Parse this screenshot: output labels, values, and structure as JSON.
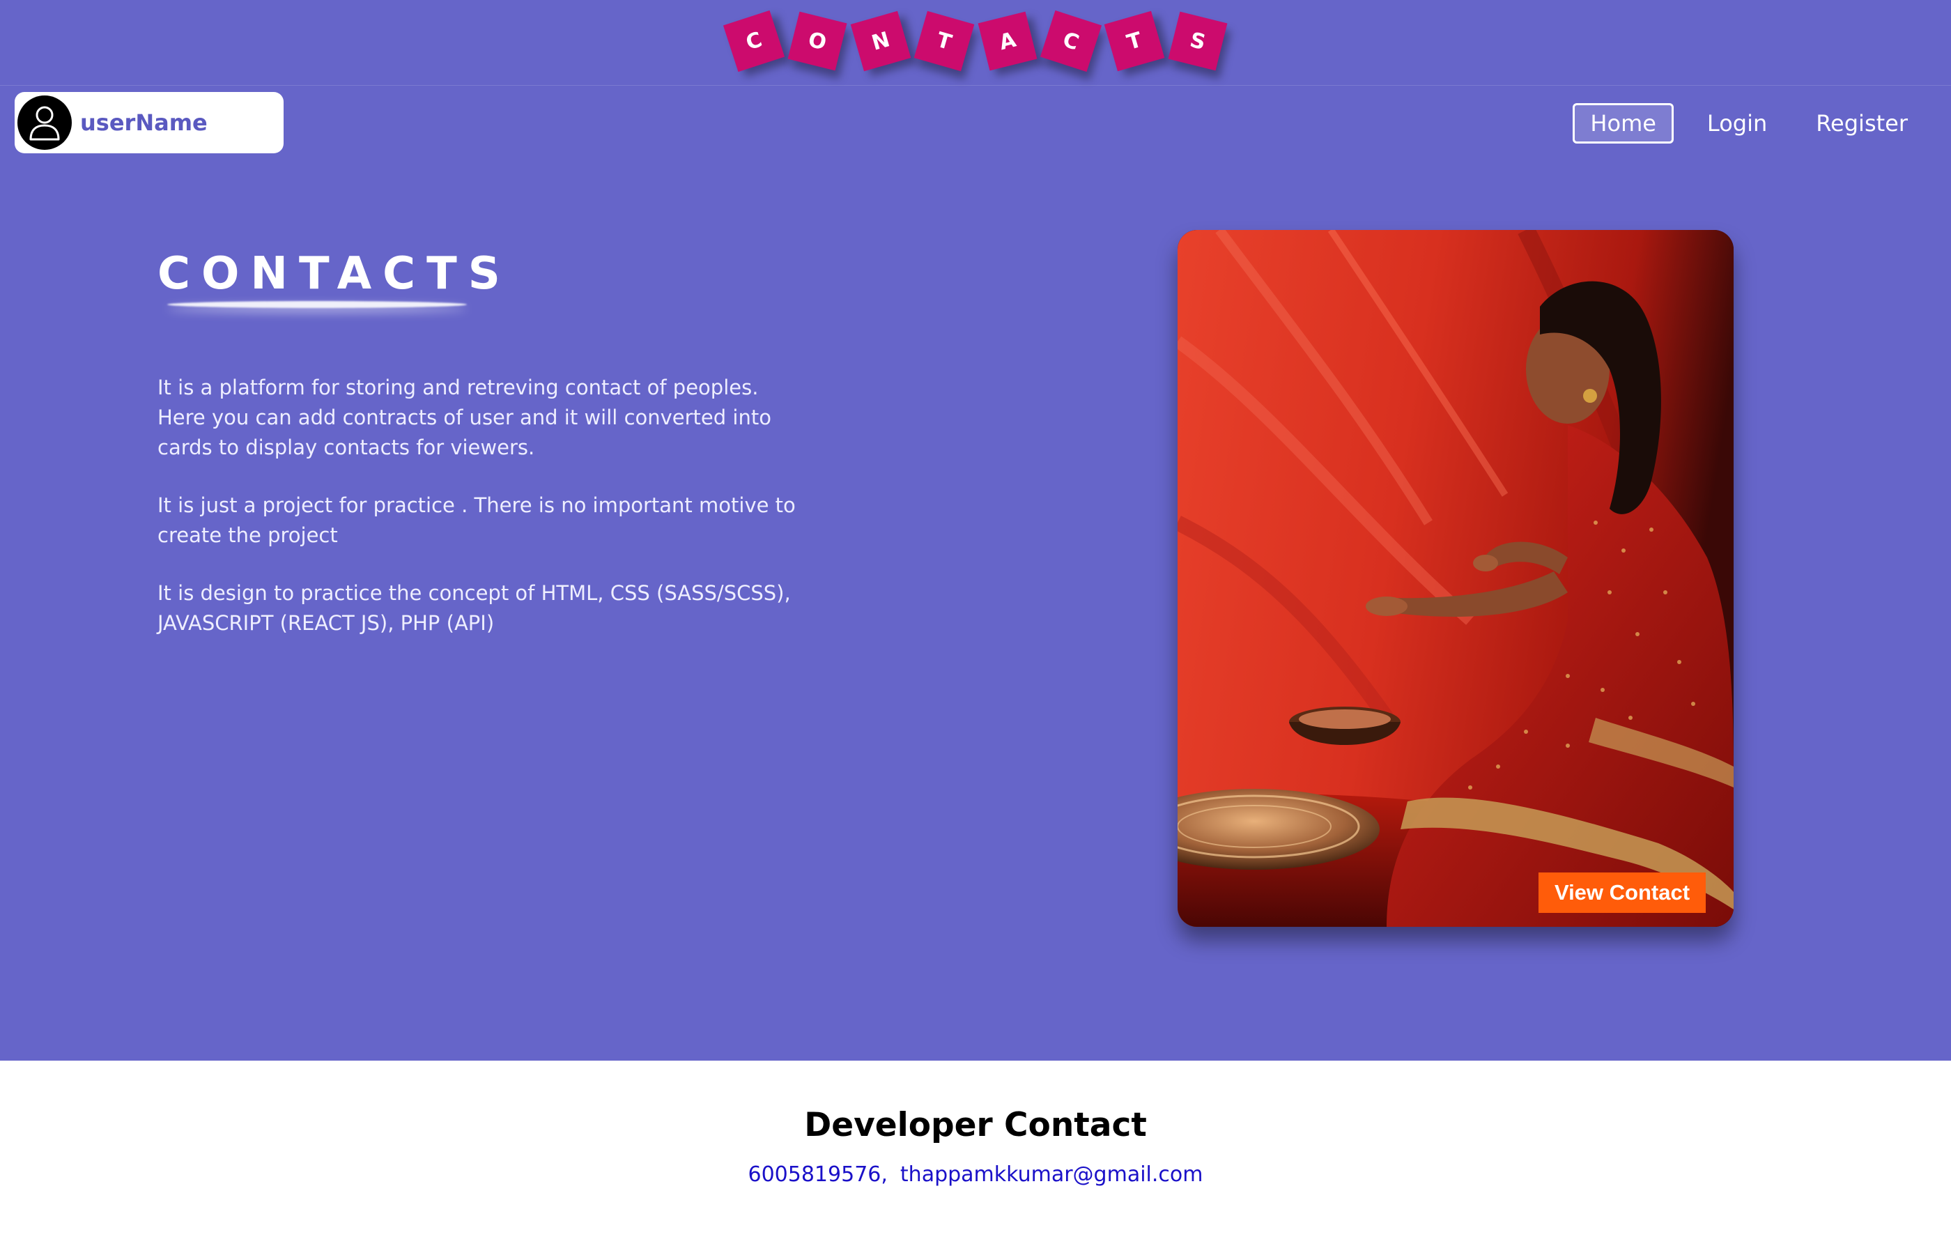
{
  "banner": {
    "letters": [
      "C",
      "O",
      "N",
      "T",
      "A",
      "C",
      "T",
      "S"
    ]
  },
  "user": {
    "name": "userName",
    "avatar_icon": "user-avatar-icon"
  },
  "nav": {
    "items": [
      {
        "label": "Home",
        "active": true
      },
      {
        "label": "Login",
        "active": false
      },
      {
        "label": "Register",
        "active": false
      }
    ]
  },
  "hero": {
    "title": "CONTACTS",
    "paragraphs": [
      "It is a platform for storing and retreving contact of peoples. Here you can add contracts of user and it will converted into cards to display contacts for viewers.",
      "It is just a project for practice . There is no important motive to create the project",
      "It is design to practice the concept of HTML, CSS (SASS/SCSS), JAVASCRIPT (REACT JS), PHP (API)"
    ]
  },
  "card": {
    "button_label": "View Contact"
  },
  "footer": {
    "title": "Developer Contact",
    "phone": "6005819576",
    "separator": ",",
    "email": "thappamkkumar@gmail.com"
  },
  "colors": {
    "background": "#6665c9",
    "tile": "#cc0b6d",
    "button": "#ff5c0a",
    "link": "#1a10c8"
  }
}
